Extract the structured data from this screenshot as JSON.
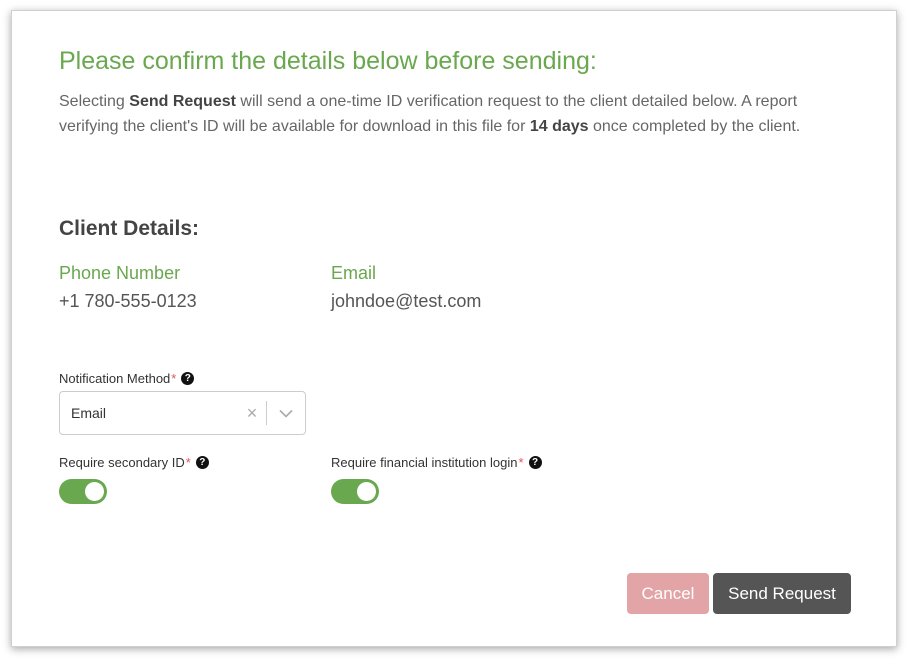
{
  "dialog": {
    "title": "Please confirm the details below before sending:",
    "intro": {
      "part1": "Selecting ",
      "bold1": "Send Request",
      "part2": " will send a one-time ID verification request to the client detailed below. A report verifying the client's ID will be available for download in this file for ",
      "bold2": "14 days",
      "part3": " once completed by the client."
    }
  },
  "client": {
    "section_title": "Client Details:",
    "phone_label": "Phone Number",
    "phone_value": "+1 780-555-0123",
    "email_label": "Email",
    "email_value": "johndoe@test.com"
  },
  "form": {
    "required_marker": "*",
    "help_glyph": "?",
    "notification_method": {
      "label": "Notification Method",
      "selected": "Email",
      "clear_glyph": "×"
    },
    "secondary_id": {
      "label": "Require secondary ID",
      "enabled": true
    },
    "financial_login": {
      "label": "Require financial institution login",
      "enabled": true
    }
  },
  "actions": {
    "cancel_label": "Cancel",
    "send_label": "Send Request"
  },
  "colors": {
    "accent": "#6aa84f",
    "cancel": "#e2a4a6",
    "send": "#555555",
    "required": "#e05555"
  },
  "icons": {
    "help": "question-circle-icon",
    "clear": "close-icon",
    "dropdown": "chevron-down-icon"
  }
}
